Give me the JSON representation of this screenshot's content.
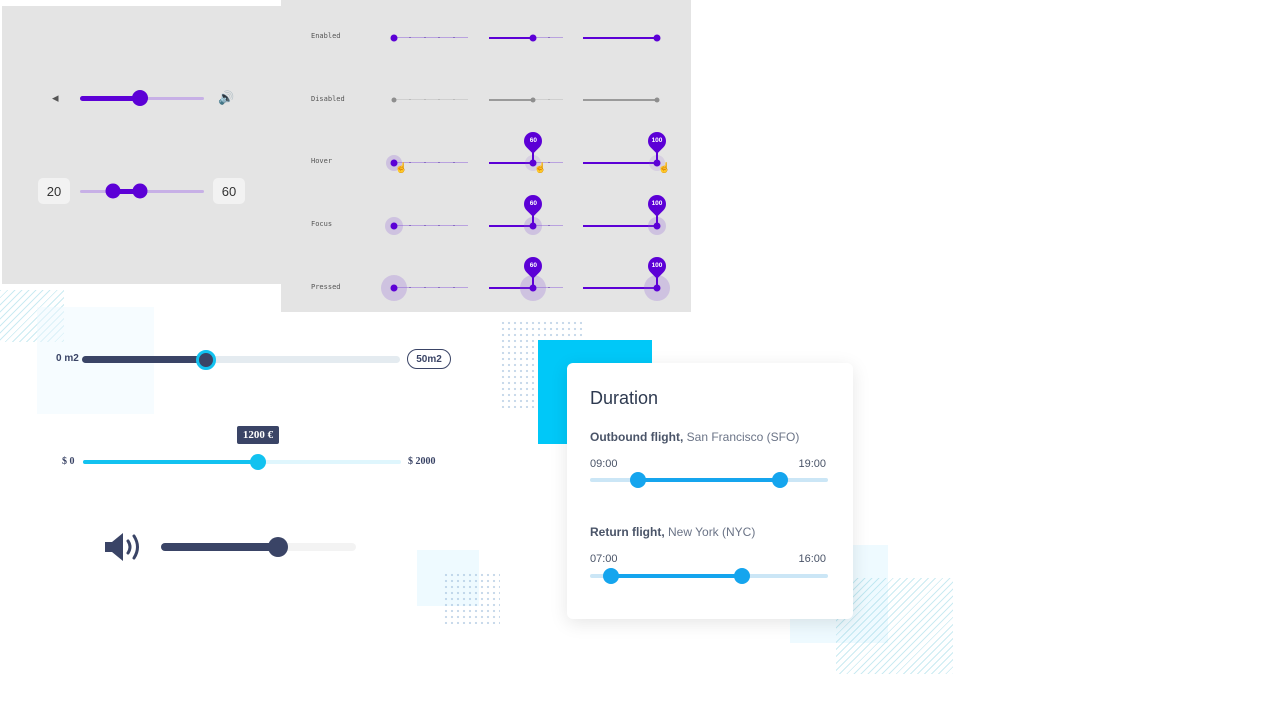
{
  "material_panel": {
    "volume_slider": {
      "value_fraction": 0.48,
      "icon_left": "volume-mute-icon",
      "icon_right": "volume-up-icon"
    },
    "range_slider": {
      "min_value": "20",
      "max_value": "60"
    }
  },
  "states_panel": {
    "rows": [
      {
        "label": "Enabled"
      },
      {
        "label": "Disabled"
      },
      {
        "label": "Hover"
      },
      {
        "label": "Focus"
      },
      {
        "label": "Pressed"
      }
    ],
    "values": [
      0,
      60,
      100
    ],
    "value_labels": [
      "60",
      "100"
    ]
  },
  "area_slider": {
    "min_label": "0 m2",
    "max_label": "50m2",
    "value_fraction": 0.39
  },
  "price_slider": {
    "min_label": "$ 0",
    "max_label": "$ 2000",
    "tooltip": "1200 €",
    "value_fraction": 0.55
  },
  "volume_slider_dark": {
    "icon": "speaker-icon",
    "value_fraction": 0.6
  },
  "duration_card": {
    "title": "Duration",
    "outbound": {
      "label_bold": "Outbound flight,",
      "label_rest": " San Francisco (SFO)",
      "start": "09:00",
      "end": "19:00",
      "start_fraction": 0.2,
      "end_fraction": 0.8
    },
    "return": {
      "label_bold": "Return flight,",
      "label_rest": " New York (NYC)",
      "start": "07:00",
      "end": "16:00",
      "start_fraction": 0.09,
      "end_fraction": 0.64
    }
  }
}
